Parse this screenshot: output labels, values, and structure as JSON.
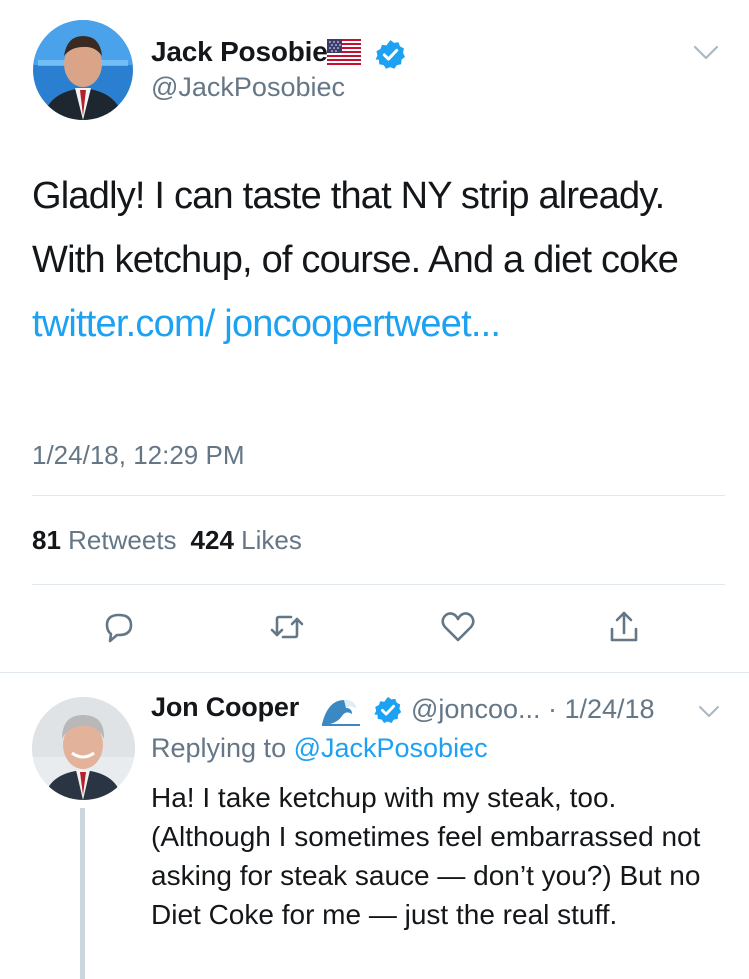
{
  "main_tweet": {
    "author_name": "Jack Posobiec",
    "author_handle": "@JackPosobiec",
    "name_emoji": "us-flag-icon",
    "text": "Gladly! I can taste that NY strip already. With ketchup, of course. And a diet coke ",
    "link_text": "twitter.com/ joncoopertweet...",
    "timestamp": "1/24/18, 12:29 PM",
    "retweets_count": "81",
    "retweets_label": "Retweets",
    "likes_count": "424",
    "likes_label": "Likes",
    "actions": [
      "reply-icon",
      "retweet-icon",
      "like-icon",
      "share-icon"
    ]
  },
  "reply_tweet": {
    "author_name": "Jon Cooper",
    "name_emoji": "wave-icon",
    "handle_and_date": "@joncoo... · 1/24/18",
    "replying_prefix": "Replying to ",
    "replying_to": "@JackPosobiec",
    "text": "Ha! I take ketchup with my steak, too. (Although I sometimes feel embarrassed not asking for steak sauce — don’t you?) But no Diet Coke for me — just the real stuff."
  },
  "colors": {
    "link": "#1da1f2",
    "secondary_text": "#657786",
    "verified": "#1da1f2",
    "divider": "#e1e8ed"
  }
}
